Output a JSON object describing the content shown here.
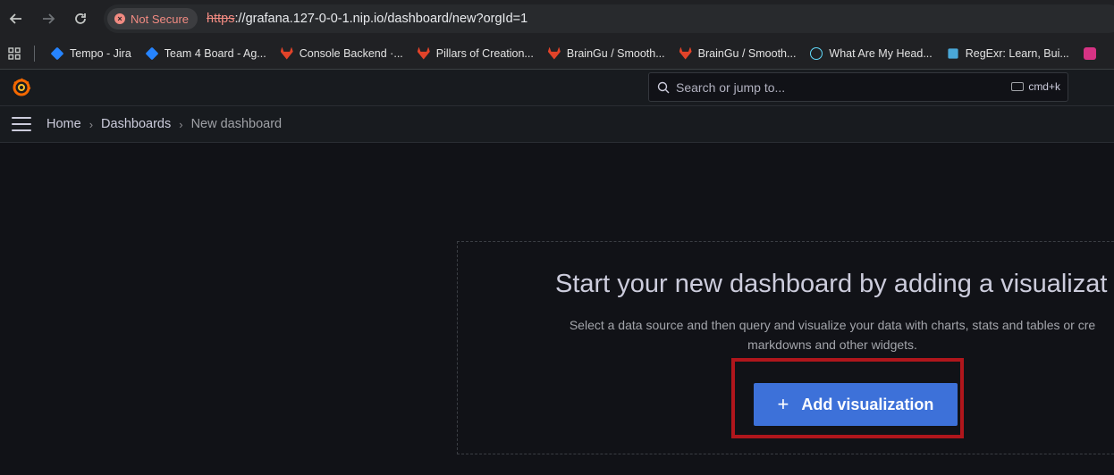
{
  "browser": {
    "security_label": "Not Secure",
    "url_scheme": "https",
    "url_rest": "://grafana.127-0-0-1.nip.io/dashboard/new?orgId=1"
  },
  "bookmarks": [
    {
      "label": "Tempo - Jira",
      "icon": "jira-icon"
    },
    {
      "label": "Team 4 Board - Ag...",
      "icon": "jira-icon"
    },
    {
      "label": "Console Backend ·...",
      "icon": "gitlab-icon"
    },
    {
      "label": "Pillars of Creation...",
      "icon": "gitlab-icon"
    },
    {
      "label": "BrainGu / Smooth...",
      "icon": "gitlab-icon"
    },
    {
      "label": "BrainGu / Smooth...",
      "icon": "gitlab-icon"
    },
    {
      "label": "What Are My Head...",
      "icon": "react-icon"
    },
    {
      "label": "RegExr: Learn, Bui...",
      "icon": "regexr-icon"
    }
  ],
  "grafana": {
    "search_placeholder": "Search or jump to...",
    "search_shortcut": "cmd+k",
    "breadcrumb": {
      "home": "Home",
      "dashboards": "Dashboards",
      "current": "New dashboard"
    },
    "empty_state": {
      "title": "Start your new dashboard by adding a visualizat",
      "desc_line1": "Select a data source and then query and visualize your data with charts, stats and tables or cre",
      "desc_line2": "markdowns and other widgets.",
      "button_label": "Add visualization",
      "button_icon": "plus-icon"
    }
  },
  "colors": {
    "accent_button": "#3d71d9",
    "highlight": "#b0161c",
    "not_secure": "#f28b82"
  }
}
